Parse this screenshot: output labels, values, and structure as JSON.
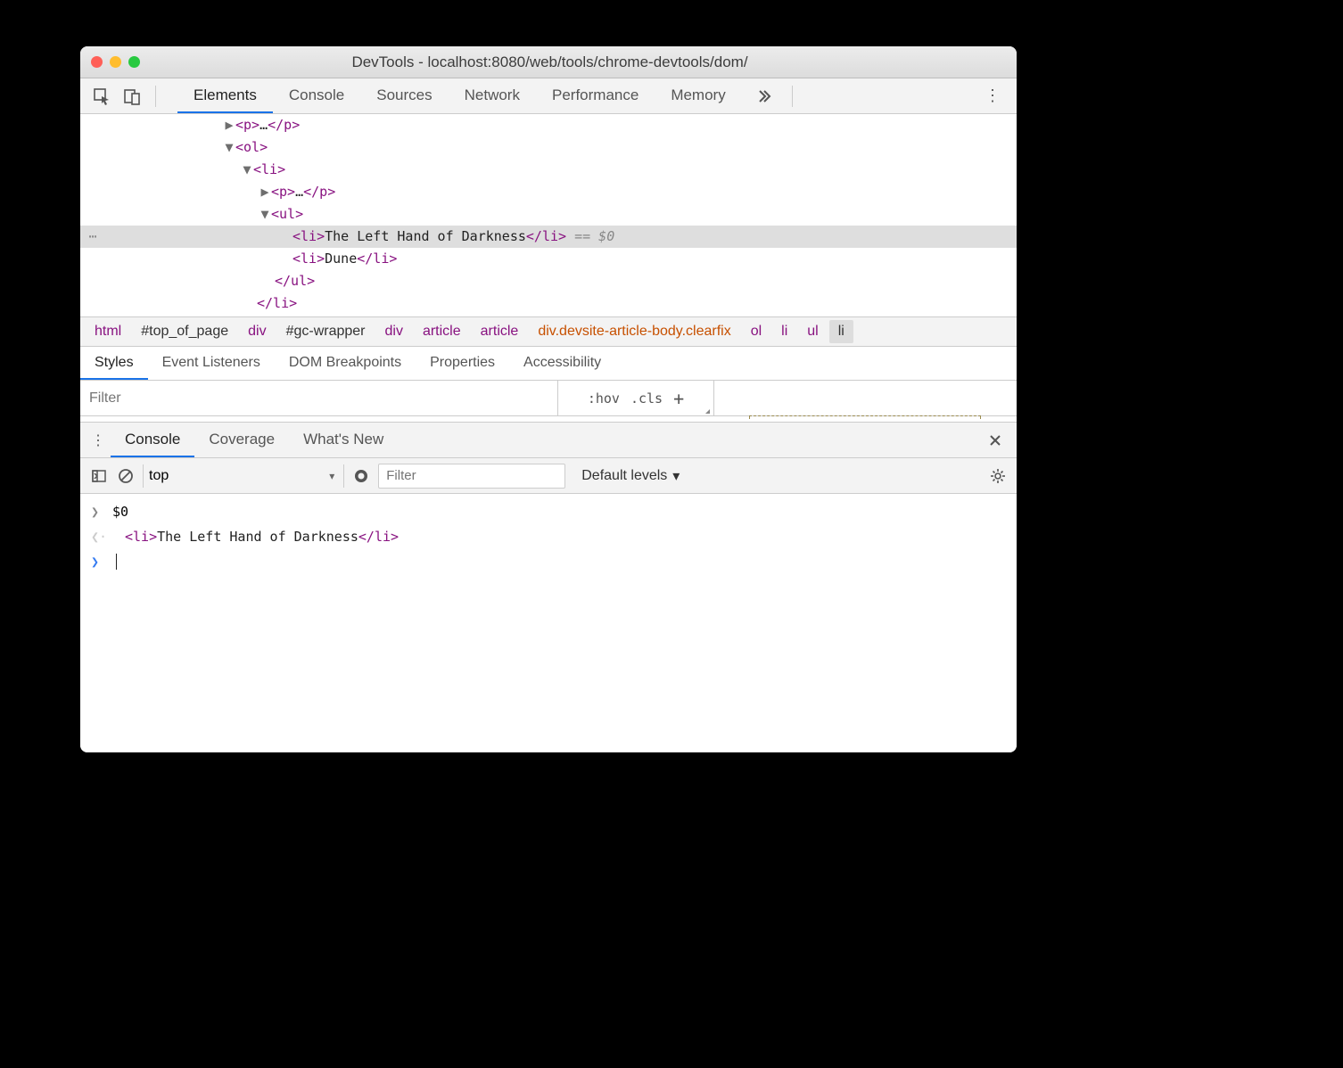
{
  "window": {
    "title": "DevTools - localhost:8080/web/tools/chrome-devtools/dom/"
  },
  "main_tabs": [
    "Elements",
    "Console",
    "Sources",
    "Network",
    "Performance",
    "Memory"
  ],
  "main_tab_active": "Elements",
  "dom_tree": {
    "rows": [
      {
        "indent": 160,
        "arrow": "▶",
        "tag_open": "<p>",
        "text": "…",
        "tag_close": "</p>"
      },
      {
        "indent": 160,
        "arrow": "▼",
        "tag_open": "<ol>",
        "text": "",
        "tag_close": ""
      },
      {
        "indent": 180,
        "arrow": "▼",
        "tag_open": "<li>",
        "text": "",
        "tag_close": ""
      },
      {
        "indent": 200,
        "arrow": "▶",
        "tag_open": "<p>",
        "text": "…",
        "tag_close": "</p>"
      },
      {
        "indent": 200,
        "arrow": "▼",
        "tag_open": "<ul>",
        "text": "",
        "tag_close": ""
      },
      {
        "indent": 238,
        "arrow": "",
        "tag_open": "<li>",
        "text": "The Left Hand of Darkness",
        "tag_close": "</li>",
        "selected": true,
        "suffix": " == $0"
      },
      {
        "indent": 238,
        "arrow": "",
        "tag_open": "<li>",
        "text": "Dune",
        "tag_close": "</li>"
      },
      {
        "indent": 218,
        "arrow": "",
        "tag_open": "</ul>",
        "text": "",
        "tag_close": ""
      },
      {
        "indent": 198,
        "arrow": "",
        "tag_open": "</li>",
        "text": "",
        "tag_close": ""
      }
    ]
  },
  "breadcrumbs": [
    {
      "label": "html",
      "kind": "tag"
    },
    {
      "label": "#top_of_page",
      "kind": "id"
    },
    {
      "label": "div",
      "kind": "tag"
    },
    {
      "label": "#gc-wrapper",
      "kind": "id"
    },
    {
      "label": "div",
      "kind": "tag"
    },
    {
      "label": "article",
      "kind": "tag"
    },
    {
      "label": "article",
      "kind": "tag"
    },
    {
      "label": "div.devsite-article-body.clearfix",
      "kind": "cls"
    },
    {
      "label": "ol",
      "kind": "tag"
    },
    {
      "label": "li",
      "kind": "tag"
    },
    {
      "label": "ul",
      "kind": "tag"
    },
    {
      "label": "li",
      "kind": "tag",
      "selected": true
    }
  ],
  "styles_tabs": [
    "Styles",
    "Event Listeners",
    "DOM Breakpoints",
    "Properties",
    "Accessibility"
  ],
  "styles_tab_active": "Styles",
  "styles_filter_placeholder": "Filter",
  "styles_hov": ":hov",
  "styles_cls": ".cls",
  "drawer_tabs": [
    "Console",
    "Coverage",
    "What's New"
  ],
  "drawer_tab_active": "Console",
  "console_toolbar": {
    "context": "top",
    "filter_placeholder": "Filter",
    "levels": "Default levels"
  },
  "console_rows": [
    {
      "arrow": ">",
      "arrow_style": "grey",
      "text": "$0"
    },
    {
      "arrow": "<·",
      "arrow_style": "dim",
      "html_open": "<li>",
      "html_text": "The Left Hand of Darkness",
      "html_close": "</li>"
    },
    {
      "arrow": ">",
      "arrow_style": "blue",
      "text": "",
      "cursor": true
    }
  ]
}
